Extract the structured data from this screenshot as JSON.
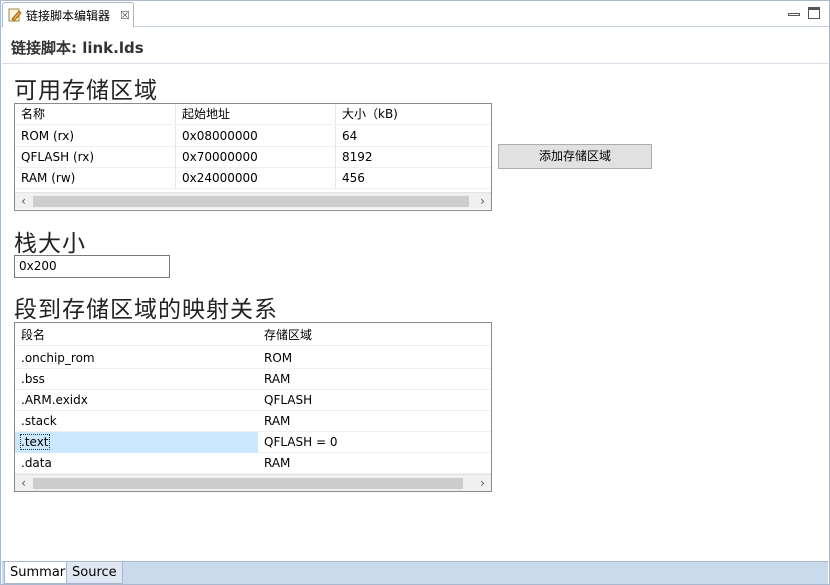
{
  "tab": {
    "title": "链接脚本编辑器",
    "close_glyph": "☒"
  },
  "header": {
    "title": "链接脚本: link.lds"
  },
  "memory": {
    "title": "可用存储区域",
    "columns": [
      "名称",
      "起始地址",
      "大小（kB)"
    ],
    "rows": [
      [
        "ROM (rx)",
        "0x08000000",
        "64"
      ],
      [
        "QFLASH (rx)",
        "0x70000000",
        "8192"
      ],
      [
        "RAM (rw)",
        "0x24000000",
        "456"
      ]
    ],
    "add_button": "添加存储区域"
  },
  "stack": {
    "title": "栈大小",
    "value": "0x200"
  },
  "mapping": {
    "title": "段到存储区域的映射关系",
    "columns": [
      "段名",
      "存储区域"
    ],
    "rows": [
      [
        ".onchip_rom",
        "ROM"
      ],
      [
        ".bss",
        "RAM"
      ],
      [
        ".ARM.exidx",
        "QFLASH"
      ],
      [
        ".stack",
        "RAM"
      ],
      [
        ".text",
        "QFLASH = 0"
      ],
      [
        ".data",
        "RAM"
      ]
    ],
    "selected_row": 4
  },
  "bottom_tabs": [
    "Summary",
    "Source"
  ],
  "colors": {
    "selection": "#cce8ff",
    "bottom_bar": "#cbdaea",
    "border": "#8a8a8a"
  }
}
